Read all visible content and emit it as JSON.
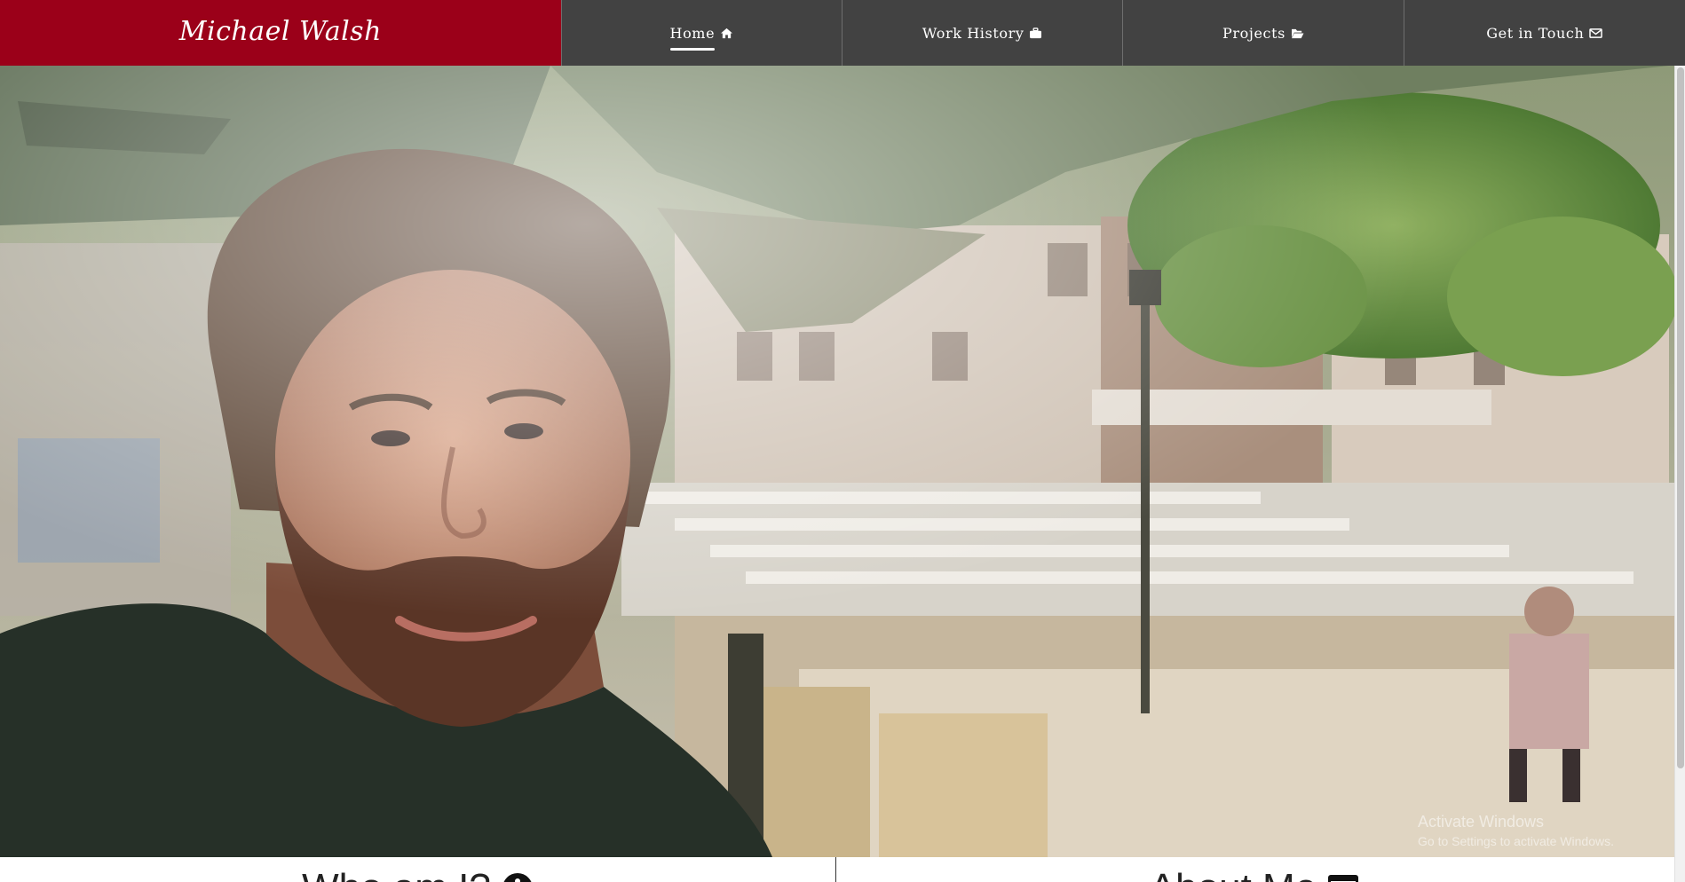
{
  "brand": {
    "name": "Michael Walsh"
  },
  "nav": {
    "items": [
      {
        "label": "Home",
        "icon": "home-icon",
        "active": true
      },
      {
        "label": "Work History",
        "icon": "briefcase-icon",
        "active": false
      },
      {
        "label": "Projects",
        "icon": "folder-open-icon",
        "active": false
      },
      {
        "label": "Get in Touch",
        "icon": "envelope-icon",
        "active": false
      }
    ]
  },
  "hero": {
    "image": "portrait-photo",
    "overlay": {
      "title": "Activate Windows",
      "subtitle": "Go to Settings to activate Windows."
    }
  },
  "sections": {
    "left": {
      "heading": "Who am I?",
      "icon": "info-circle-icon"
    },
    "right": {
      "heading": "About Me",
      "icon": "card-icon"
    }
  },
  "colors": {
    "brand_bg": "#9b0019",
    "nav_bg": "#424242",
    "nav_text": "#ffffff"
  }
}
